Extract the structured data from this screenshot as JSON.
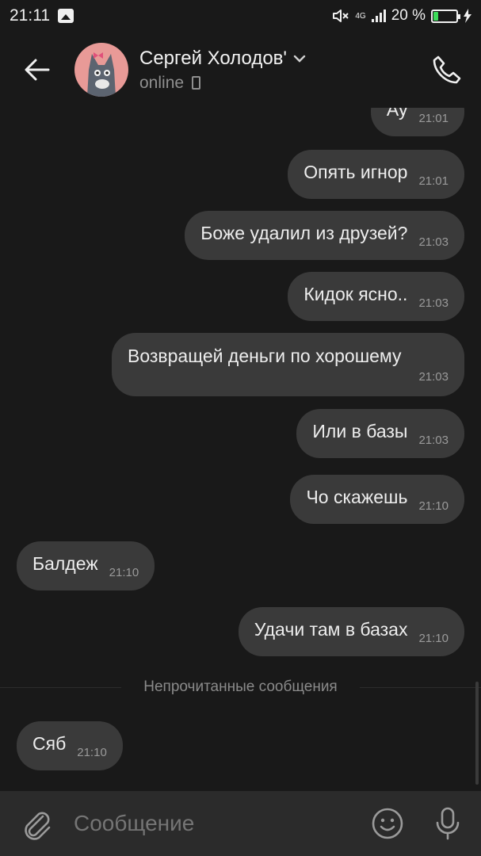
{
  "status_bar": {
    "time": "21:11",
    "network": "4G",
    "battery_percent_label": "20 %",
    "battery_level": 0.2,
    "battery_color": "#3ddc5a"
  },
  "header": {
    "contact_name": "Сергей Холодов'",
    "status": "online",
    "avatar_color": "#e89a97"
  },
  "messages": [
    {
      "side": "out",
      "text": "Ау",
      "time": "21:01"
    },
    {
      "side": "out",
      "text": "Опять игнор",
      "time": "21:01"
    },
    {
      "side": "out",
      "text": "Боже удалил из друзей?",
      "time": "21:03"
    },
    {
      "side": "out",
      "text": "Кидок ясно..",
      "time": "21:03"
    },
    {
      "side": "out",
      "text": "Возвращей деньги по хорошему",
      "time": "21:03"
    },
    {
      "side": "out",
      "text": "Или в базы",
      "time": "21:03"
    },
    {
      "side": "out",
      "text": "Чо скажешь",
      "time": "21:10"
    },
    {
      "side": "in",
      "text": "Балдеж",
      "time": "21:10"
    },
    {
      "side": "out",
      "text": "Удачи там в базах",
      "time": "21:10"
    },
    {
      "side": "in",
      "text": "Сяб",
      "time": "21:10"
    }
  ],
  "unread_divider": "Непрочитанные сообщения",
  "composer": {
    "placeholder": "Сообщение"
  },
  "colors": {
    "background": "#191919",
    "bubble": "#3a3a3a",
    "composer": "#2b2b2b"
  }
}
